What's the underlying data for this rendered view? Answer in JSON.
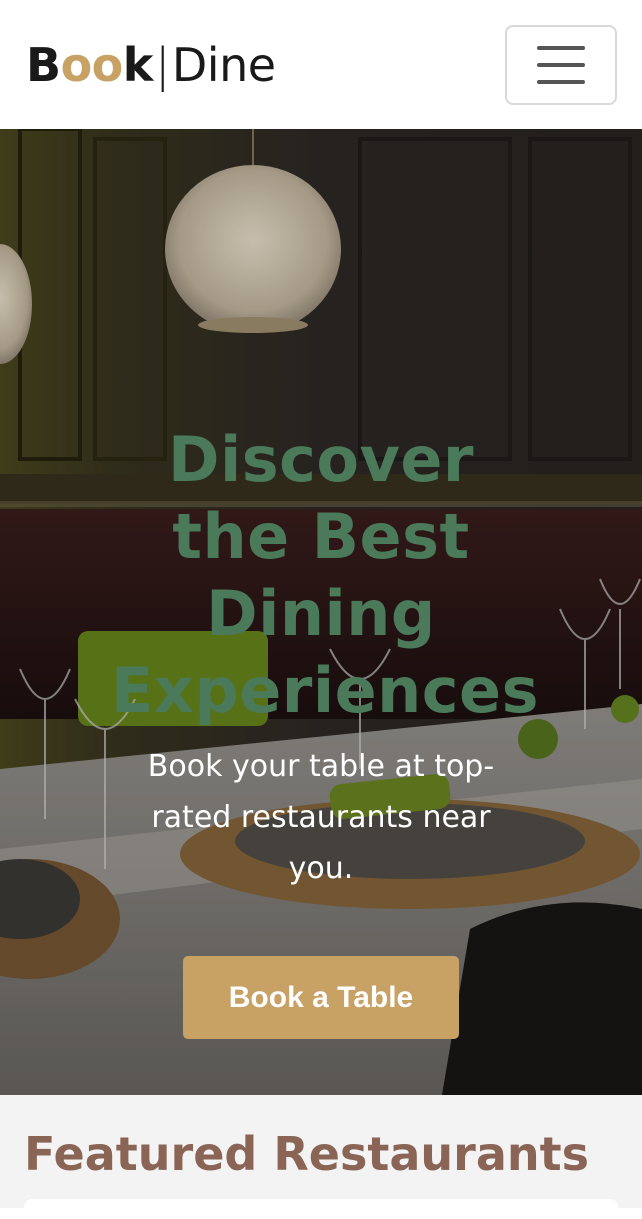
{
  "brand": {
    "part1": "B",
    "part2": "oo",
    "part3": "k",
    "separator": "|",
    "part4": "Dine"
  },
  "nav": {
    "toggler_icon": "hamburger-menu-icon"
  },
  "hero": {
    "title": "Discover the Best Dining Experiences",
    "subtitle": "Book your table at top-rated restaurants near you.",
    "cta_label": "Book a Table",
    "image": "restaurant-interior-photo"
  },
  "featured": {
    "title": "Featured Restaurants"
  },
  "colors": {
    "accent": "#c8a165",
    "hero_title": "#4b7a5a",
    "featured_title": "#8a6556",
    "section_bg": "#f3f3f3"
  }
}
